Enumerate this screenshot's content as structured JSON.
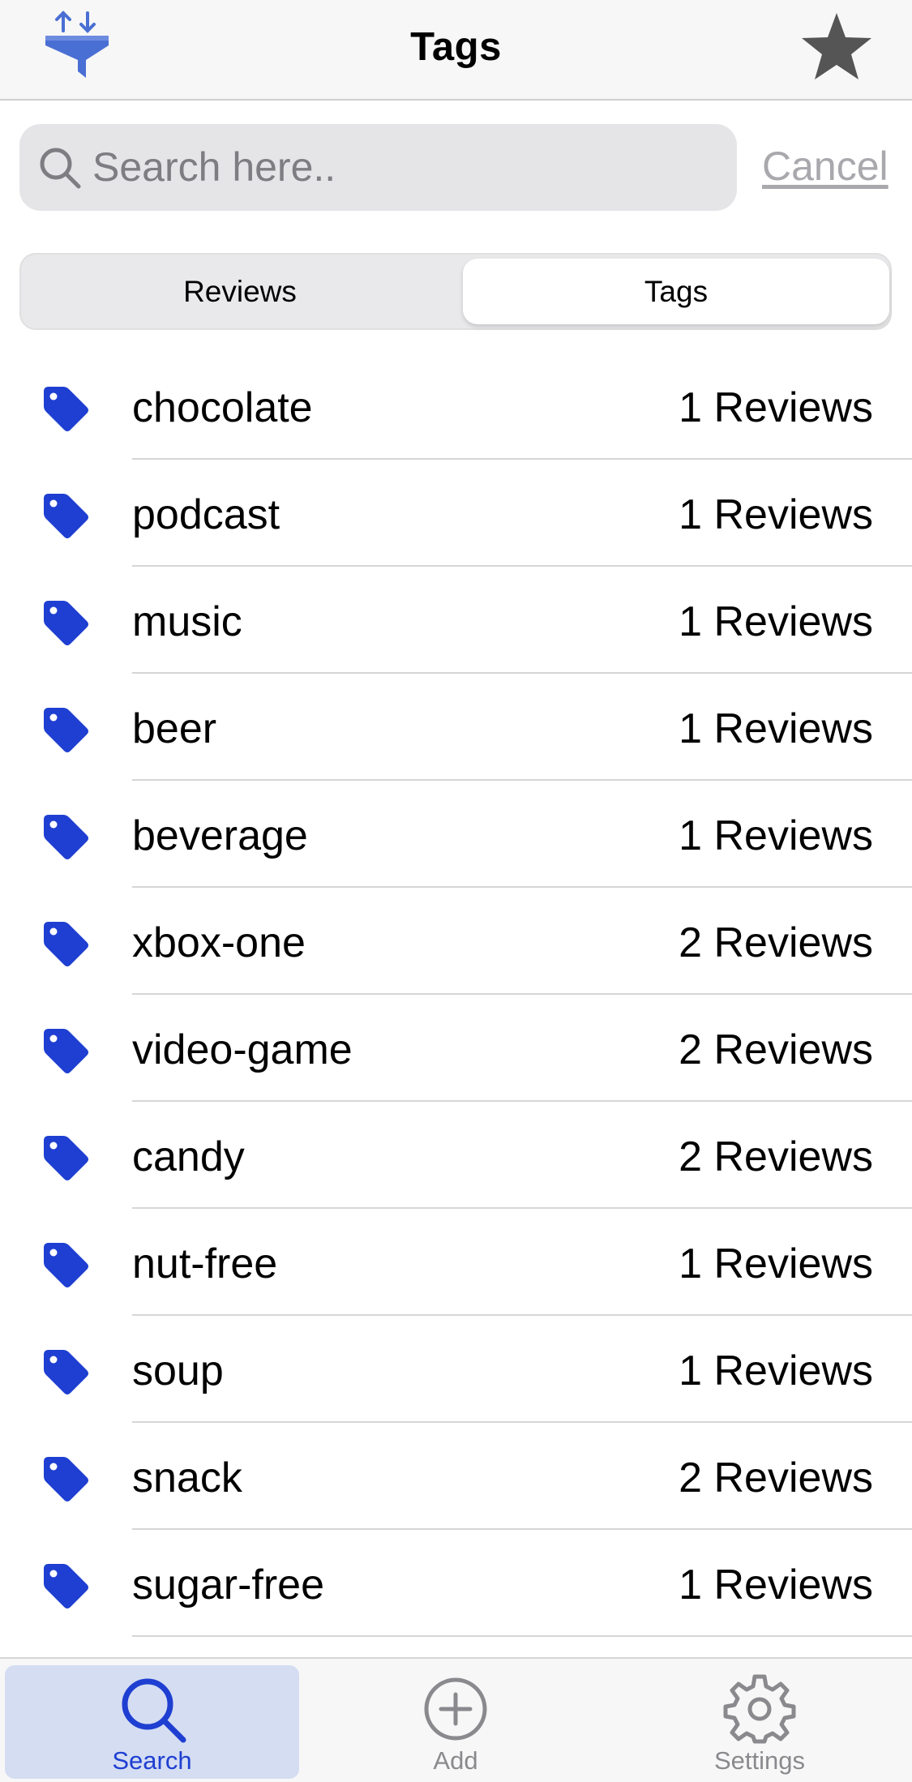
{
  "colors": {
    "accent": "#1e3fd1",
    "tab_inactive": "#8a8a8e",
    "filter_icon": "#4a6fd4"
  },
  "navbar": {
    "title": "Tags",
    "left_icon": "sort-filter-icon",
    "right_icon": "star-icon"
  },
  "search": {
    "placeholder": "Search here..",
    "value": "",
    "cancel_label": "Cancel"
  },
  "segments": {
    "items": [
      {
        "label": "Reviews",
        "selected": false
      },
      {
        "label": "Tags",
        "selected": true
      }
    ]
  },
  "tags": [
    {
      "name": "chocolate",
      "count": "1 Reviews"
    },
    {
      "name": "podcast",
      "count": "1 Reviews"
    },
    {
      "name": "music",
      "count": "1 Reviews"
    },
    {
      "name": "beer",
      "count": "1 Reviews"
    },
    {
      "name": "beverage",
      "count": "1 Reviews"
    },
    {
      "name": "xbox-one",
      "count": "2 Reviews"
    },
    {
      "name": "video-game",
      "count": "2 Reviews"
    },
    {
      "name": "candy",
      "count": "2 Reviews"
    },
    {
      "name": "nut-free",
      "count": "1 Reviews"
    },
    {
      "name": "soup",
      "count": "1 Reviews"
    },
    {
      "name": "snack",
      "count": "2 Reviews"
    },
    {
      "name": "sugar-free",
      "count": "1 Reviews"
    }
  ],
  "tabbar": {
    "items": [
      {
        "label": "Search",
        "icon": "search-icon",
        "selected": true
      },
      {
        "label": "Add",
        "icon": "plus-circle-icon",
        "selected": false
      },
      {
        "label": "Settings",
        "icon": "gear-icon",
        "selected": false
      }
    ]
  }
}
